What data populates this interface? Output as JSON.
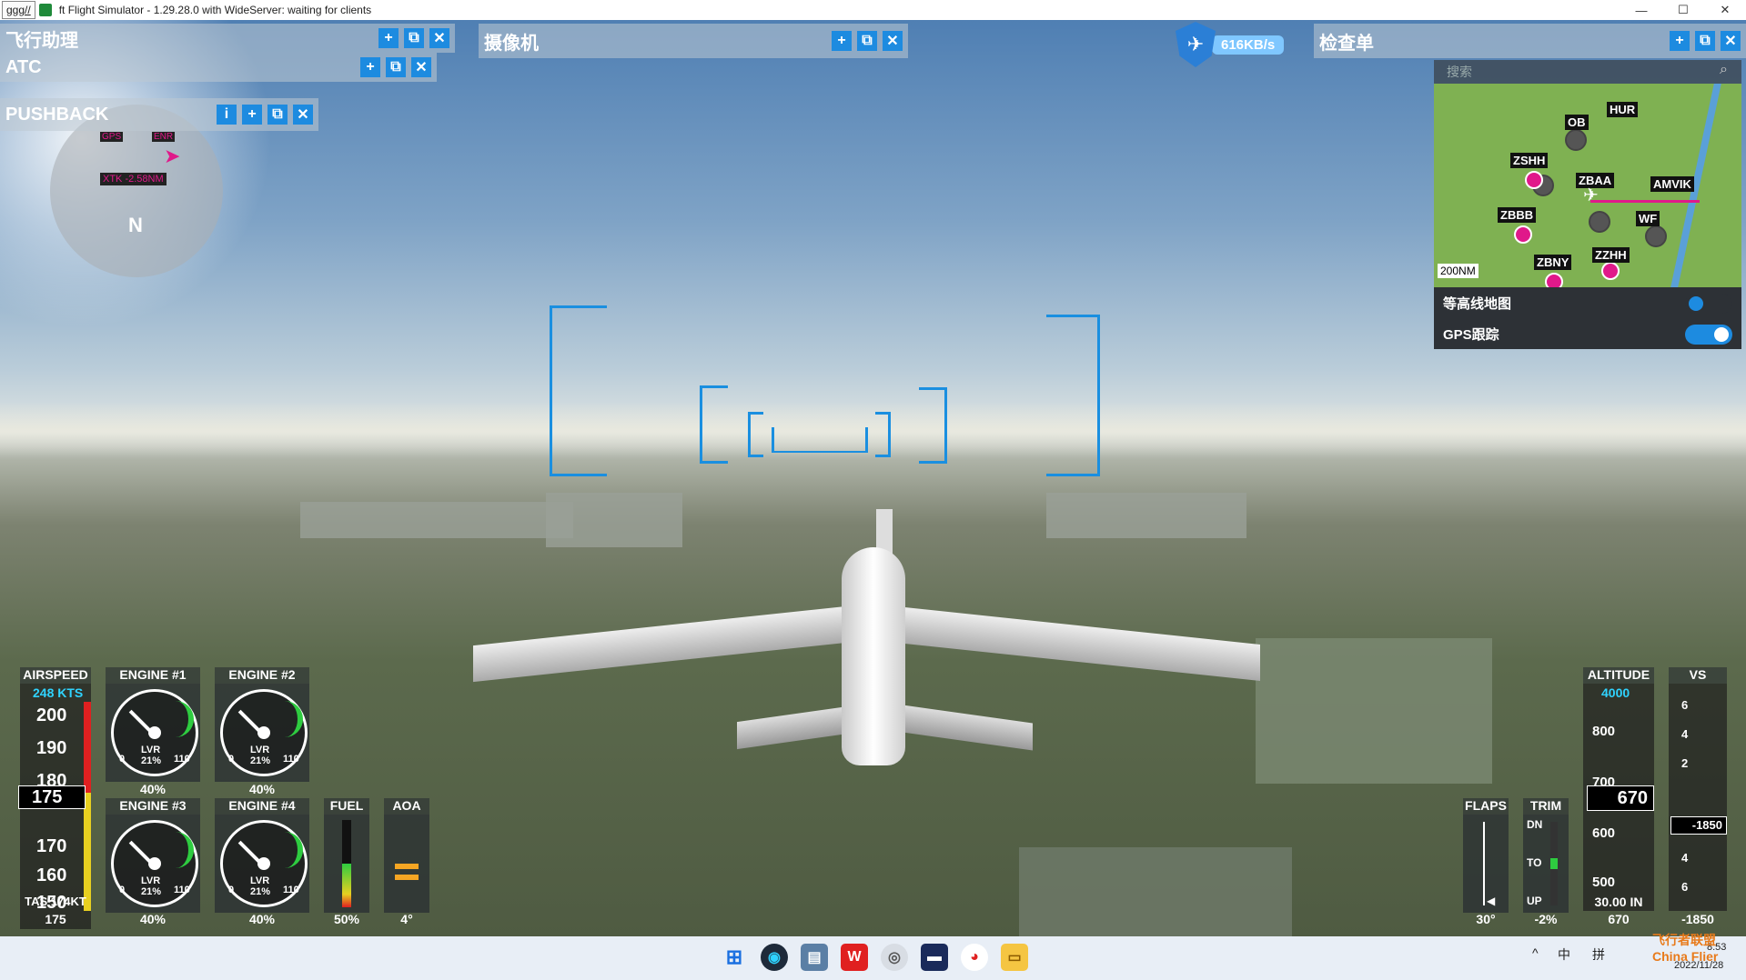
{
  "window": {
    "tab_label": "ggg//",
    "title": "ft Flight Simulator - 1.29.28.0 with WideServer: waiting for clients",
    "minimize": "—",
    "maximize": "☐",
    "close": "✕"
  },
  "panels": {
    "flight_assist": "飞行助理",
    "camera": "摄像机",
    "checklist": "检查单",
    "atc": "ATC",
    "pushback": "PUSHBACK",
    "add_icon": "+",
    "popout_icon": "⧉",
    "close_icon": "✕",
    "info_icon": "i"
  },
  "network": {
    "speed": "616KB/s"
  },
  "map": {
    "search_placeholder": "搜索",
    "labels": [
      "OB",
      "HUR",
      "ZSHH",
      "ZBAA",
      "AMVIK",
      "ZBBB",
      "WF",
      "ZZHH",
      "ZBNY"
    ],
    "scale": "200NM",
    "toggles": [
      {
        "label": "等高线地图",
        "on": false
      },
      {
        "label": "GPS跟踪",
        "on": true
      }
    ],
    "accent": "#1d8be0"
  },
  "compass": {
    "heading_letter": "N",
    "xtk": "XTK -2.58NM",
    "gps": "GPS",
    "enr": "ENR"
  },
  "instruments": {
    "airspeed": {
      "title": "AIRSPEED",
      "selected": "248 KTS",
      "ticks": [
        "200",
        "190",
        "180",
        "175",
        "170",
        "160",
        "150"
      ],
      "current": "175",
      "tas": "TAS 174KT",
      "footer": "175"
    },
    "engines": [
      {
        "title": "ENGINE #1",
        "lvr": "LVR",
        "pct": "21%",
        "min": "0",
        "max": "110",
        "value": "40%"
      },
      {
        "title": "ENGINE #2",
        "lvr": "LVR",
        "pct": "21%",
        "min": "0",
        "max": "110",
        "value": "40%"
      },
      {
        "title": "ENGINE #3",
        "lvr": "LVR",
        "pct": "21%",
        "min": "0",
        "max": "110",
        "value": "40%"
      },
      {
        "title": "ENGINE #4",
        "lvr": "LVR",
        "pct": "21%",
        "min": "0",
        "max": "110",
        "value": "40%"
      }
    ],
    "fuel": {
      "title": "FUEL",
      "value": "50%",
      "level": 0.5
    },
    "aoa": {
      "title": "AOA",
      "value": "4°"
    },
    "flaps": {
      "title": "FLAPS",
      "value": "30°"
    },
    "trim": {
      "title": "TRIM",
      "dn": "DN",
      "to": "TO",
      "up": "UP",
      "value": "-2%"
    },
    "altitude": {
      "title": "ALTITUDE",
      "selected": "4000",
      "ticks": [
        "800",
        "700",
        "670",
        "600",
        "500"
      ],
      "current": "670",
      "baro": "30.00 IN",
      "footer": "670"
    },
    "vs": {
      "title": "VS",
      "ticks": [
        "6",
        "4",
        "2",
        "2",
        "4",
        "6"
      ],
      "current": "-1850",
      "footer": "-1850"
    }
  },
  "taskbar": {
    "tray_chevron": "^",
    "ime": "中",
    "ime2": "拼",
    "time": "8:53",
    "date": "2022/11/28",
    "watermark": "飞行者联盟 China Flier"
  }
}
